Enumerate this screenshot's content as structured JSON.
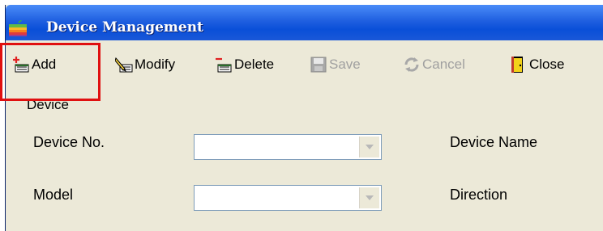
{
  "window": {
    "title": "Device Management"
  },
  "toolbar": {
    "add_label": "Add",
    "add_label_second_line": "Device",
    "modify_label": "Modify",
    "delete_label": "Delete",
    "save_label": "Save",
    "cancel_label": "Cancel",
    "close_label": "Close"
  },
  "form": {
    "device_no_label": "Device No.",
    "device_name_label": "Device Name",
    "model_label": "Model",
    "direction_label": "Direction"
  },
  "colors": {
    "titlebar": "#1F5FE0",
    "window_bg": "#ECE9D8",
    "highlight": "#E01010"
  }
}
